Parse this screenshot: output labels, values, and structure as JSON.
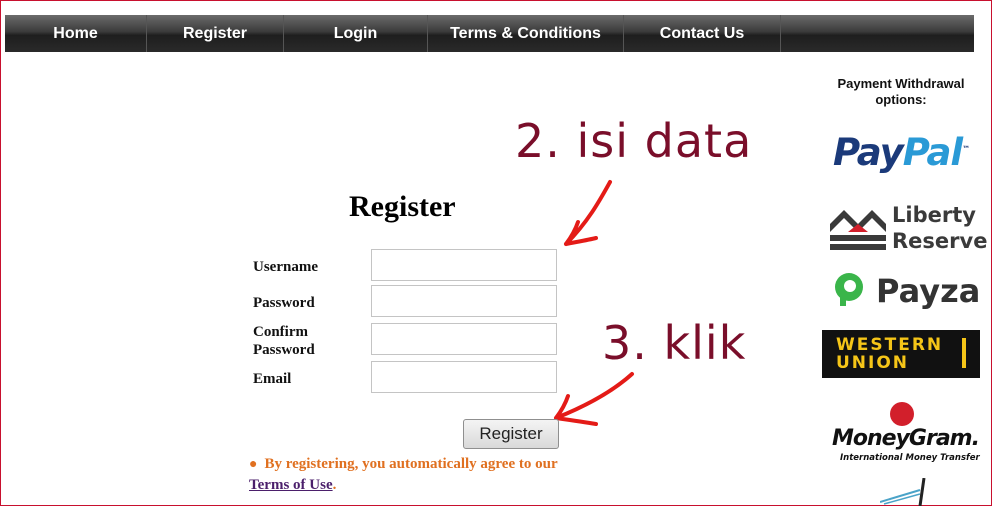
{
  "nav": {
    "items": [
      {
        "label": "Home"
      },
      {
        "label": "Register"
      },
      {
        "label": "Login"
      },
      {
        "label": "Terms & Conditions"
      },
      {
        "label": "Contact Us"
      }
    ]
  },
  "annotations": {
    "step2": "2. isi data",
    "step3": "3. klik",
    "color": "#7a0e2a",
    "arrow_color": "#e41b17"
  },
  "form": {
    "title": "Register",
    "fields": [
      {
        "label": "Username",
        "value": ""
      },
      {
        "label": "Password",
        "value": ""
      },
      {
        "label": "Confirm Password",
        "value": ""
      },
      {
        "label": "Email",
        "value": ""
      }
    ],
    "submit_label": "Register",
    "agreement_text": "By registering, you automatically agree to our",
    "terms_link": "Terms of Use",
    "agreement_end": "."
  },
  "sidebar": {
    "title": "Payment Withdrawal options:",
    "logos": [
      {
        "name": "paypal-logo",
        "text_a": "Pay",
        "text_b": "Pal",
        "mark": "™"
      },
      {
        "name": "liberty-reserve-logo",
        "line1": "Liberty",
        "line2": "Reserve"
      },
      {
        "name": "payza-logo",
        "text": "Payza"
      },
      {
        "name": "western-union-logo",
        "line1": "WESTERN",
        "line2": "UNION"
      },
      {
        "name": "moneygram-logo",
        "text": "MoneyGram.",
        "sub": "International Money Transfer"
      }
    ]
  }
}
